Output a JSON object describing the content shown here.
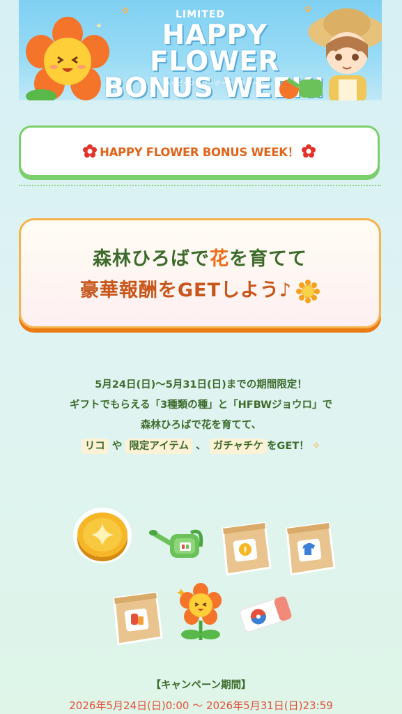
{
  "banner": {
    "limited": "LIMITED",
    "title_line1": "HAPPY FLOWER",
    "title_line2": "BONUS WEEK!",
    "kana": "ハッピーフラワーボーナスウィーク"
  },
  "header": {
    "text": "HAPPY FLOWER BONUS WEEK！"
  },
  "card": {
    "line1_pre": "森林ひろばで",
    "line1_accent": "花",
    "line1_post": "を育てて",
    "line2": "豪華報酬をGETしよう♪"
  },
  "description": {
    "line1": "5月24日(日)〜5月31日(日)までの期間限定！",
    "line2": "ギフトでもらえる「3種類の種」と「HFBWジョウロ」で",
    "line3": "森林ひろばで花を育てて、",
    "chip1": "リコ",
    "mid1": "や",
    "chip2": "限定アイテム",
    "mid2": "、",
    "chip3": "ガチャチケ",
    "tail": "をGET！"
  },
  "campaign": {
    "label": "【キャンペーン期間】",
    "dates": "2026年5月24日(日)0:00 〜 2026年5月31日(日)23:59"
  },
  "icons": {
    "items": [
      "coin-icon",
      "watering-can-icon",
      "seed-bag-coin-icon",
      "seed-bag-shirt-icon",
      "seed-bag-item-icon",
      "flower-icon",
      "gacha-ticket-icon"
    ]
  },
  "colors": {
    "green_border": "#7bcf6a",
    "orange_border": "#f7b24a",
    "text_green": "#3d6b2c",
    "accent_orange": "#ec6b1a",
    "date_red": "#e4503a"
  }
}
